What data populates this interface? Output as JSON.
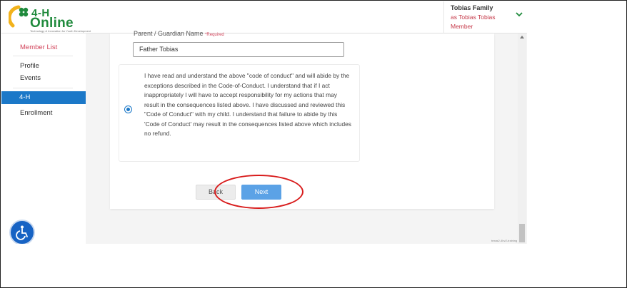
{
  "header": {
    "logo": {
      "top_text": "4-H",
      "main_text": "Online",
      "tagline": "Technology & Innovation for Youth Development"
    },
    "user": {
      "name": "Tobias Family",
      "acting_as": "as Tobias Tobias",
      "role": "Member"
    }
  },
  "sidebar": {
    "member_list": "Member List",
    "profile": "Profile",
    "events": "Events",
    "active_section": "4-H",
    "enrollment": "Enrollment"
  },
  "form": {
    "guardian_label": "Parent / Guardian Name",
    "guardian_required": "*Required",
    "guardian_value": "Father Tobias",
    "agreement_text": "I have read and understand the above \"code of conduct\" and will abide by the exceptions described in the Code-of-Conduct. I understand that if I act inappropriately I will have to accept responsibility for my actions that may result in the consequences listed above. I have discussed and reviewed this \"Code of Conduct\" with my child. I understand that failure to abide by this 'Code of Conduct' may result in the consequences listed above which includes no refund.",
    "agreement_checked": true,
    "back_label": "Back",
    "next_label": "Next"
  },
  "footer": {
    "build_tag": "texas2-4hv2-training"
  },
  "colors": {
    "brand_green": "#1f8a3c",
    "accent_red": "#d2435a",
    "active_blue": "#1b78c8",
    "next_blue": "#5ba2e6",
    "highlight_ring": "#d81b1b"
  }
}
